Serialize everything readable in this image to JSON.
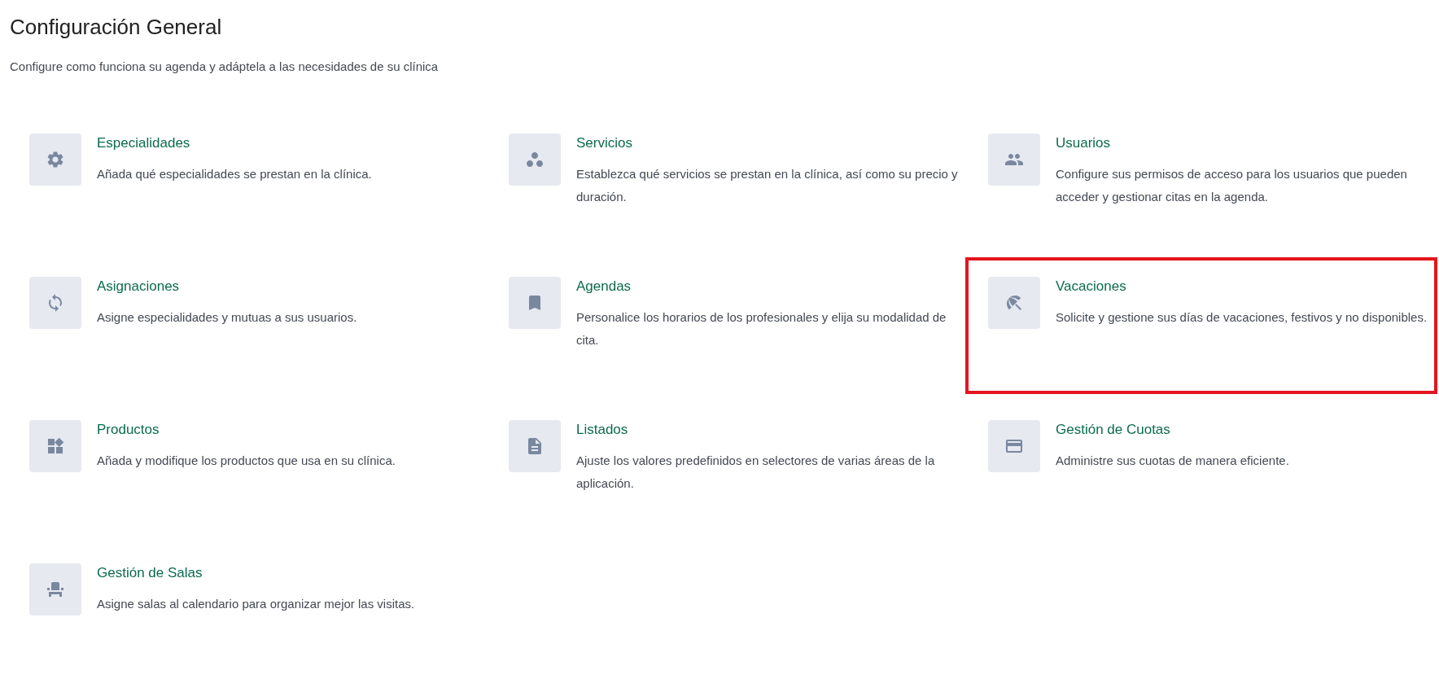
{
  "title": "Configuración General",
  "subtitle": "Configure como funciona su agenda y adáptela a las necesidades de su clínica",
  "sections": [
    {
      "title": "Especialidades",
      "description": "Añada qué especialidades se prestan en la clínica.",
      "highlighted": false
    },
    {
      "title": "Servicios",
      "description": "Establezca qué servicios se prestan en la clínica, así como su precio y duración.",
      "highlighted": false
    },
    {
      "title": "Usuarios",
      "description": "Configure sus permisos de acceso para los usuarios que pueden acceder y gestionar citas en la agenda.",
      "highlighted": false
    },
    {
      "title": "Asignaciones",
      "description": "Asigne especialidades y mutuas a sus usuarios.",
      "highlighted": false
    },
    {
      "title": "Agendas",
      "description": "Personalice los horarios de los profesionales y elija su modalidad de cita.",
      "highlighted": false
    },
    {
      "title": "Vacaciones",
      "description": "Solicite y gestione sus días de vacaciones, festivos y no disponibles.",
      "highlighted": true
    },
    {
      "title": "Productos",
      "description": "Añada y modifique los productos que usa en su clínica.",
      "highlighted": false
    },
    {
      "title": "Listados",
      "description": "Ajuste los valores predefinidos en selectores de varias áreas de la aplicación.",
      "highlighted": false
    },
    {
      "title": "Gestión de Cuotas",
      "description": "Administre sus cuotas de manera eficiente.",
      "highlighted": false
    },
    {
      "title": "Gestión de Salas",
      "description": "Asigne salas al calendario para organizar mejor las visitas.",
      "highlighted": false
    }
  ]
}
